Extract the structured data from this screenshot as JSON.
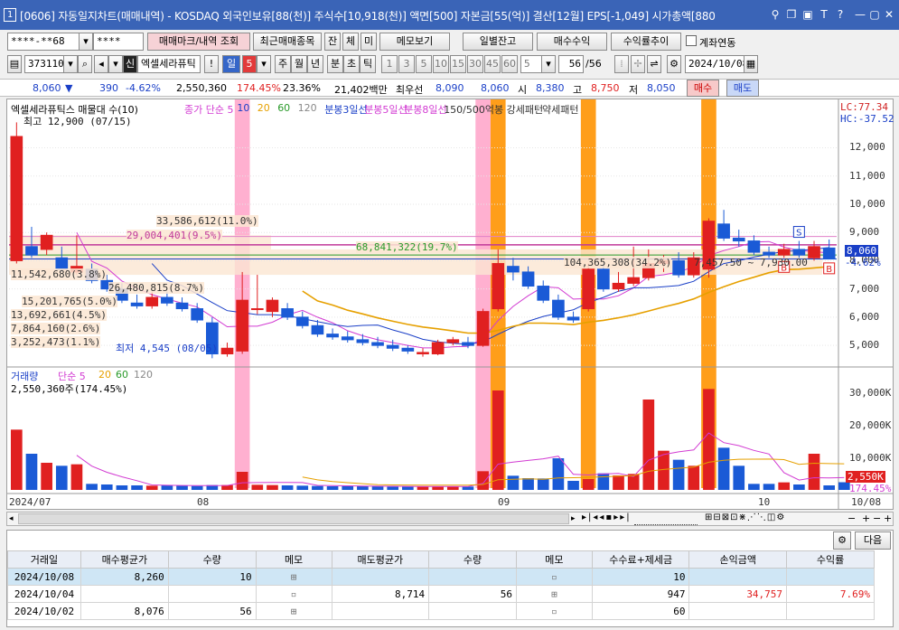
{
  "window": {
    "number": "1",
    "title": "[0606] 자동일지차트(매매내역) - KOSDAQ 외국인보유[88(천)] 주식수[10,918(천)] 액면[500] 자본금[55(억)] 결산[12월] EPS[-1,049] 시가총액[880"
  },
  "toolbar1": {
    "account": "****-**68",
    "password": "****",
    "buttons": [
      "매매마크/내역 조회",
      "최근매매종목",
      "잔",
      "체",
      "미",
      "메모보기",
      "일별잔고",
      "매수수익",
      "수익률추이"
    ],
    "checkbox_label": "계좌연동"
  },
  "toolbar2": {
    "code": "373110",
    "stock_name": "엑셀세라퓨틱",
    "period_day": "일",
    "period_value": "5",
    "periods": [
      "주",
      "월",
      "년",
      "분",
      "초",
      "틱"
    ],
    "intervals": [
      "1",
      "3",
      "5",
      "10",
      "15",
      "30",
      "45",
      "60"
    ],
    "interval_value": "5",
    "page": "56",
    "page_total": "/56",
    "date": "2024/10/08"
  },
  "quote": {
    "price": "8,060",
    "change": "390",
    "change_pct": "-4.62%",
    "volume": "2,550,360",
    "vol_ratio": "174.45%",
    "turnover": "23.36%",
    "amount": "21,402백만",
    "bid_label": "최우선",
    "bid1": "8,090",
    "bid2": "8,060",
    "open_label": "시",
    "open": "8,380",
    "high_label": "고",
    "high": "8,750",
    "low_label": "저",
    "low": "8,050",
    "buy": "매수",
    "sell": "매도"
  },
  "chart_data": {
    "type": "candlestick",
    "title": "엑셀세라퓨틱스 매물대 수(10)",
    "legend": [
      {
        "label": "종가 단순 5",
        "color": "#d23bd2"
      },
      {
        "label": "10",
        "color": "#1a3fc7"
      },
      {
        "label": "20",
        "color": "#e6a000"
      },
      {
        "label": "60",
        "color": "#2a9a2a"
      },
      {
        "label": "120",
        "color": "#888888"
      },
      {
        "label": "분봉3일선",
        "color": "#1a3fc7"
      },
      {
        "label": "분봉5일선",
        "color": "#d23bd2"
      },
      {
        "label": "분봉8일선",
        "color": "#d23bd2"
      },
      {
        "label": "150/500억봉 강세패턴",
        "color": "#333333"
      },
      {
        "label": "약세패턴",
        "color": "#333333"
      }
    ],
    "y_ticks": [
      12000,
      11000,
      10000,
      9000,
      8000,
      7000,
      6000,
      5000
    ],
    "ylim": [
      4300,
      13200
    ],
    "lc": "LC:77.34",
    "hc": "HC:-37.52",
    "last_price_label": "8,060",
    "last_pct_label": "-4.62%",
    "x_labels": [
      "2024/07",
      "08",
      "09",
      "10",
      "10/08"
    ],
    "max_label": "최고 12,900 (07/15)",
    "min_label": "최저 4,545 (08/05)",
    "volume_profile": [
      "33,586,612(11.0%)",
      "29,004,401(9.5%)",
      "68,841,322(19.7%)",
      "11,542,680(3.8%)",
      "26,480,815(8.7%)",
      "15,201,765(5.0%)",
      "13,692,661(4.5%)",
      "7,864,160(2.6%)",
      "3,252,473(1.1%)",
      "104,365,308(34.2%)"
    ],
    "range_note": "7,457.50 ~ 7,930.00",
    "candles": [
      {
        "o": 8000,
        "h": 12900,
        "l": 7900,
        "c": 12400
      },
      {
        "o": 8500,
        "h": 9200,
        "l": 8100,
        "c": 8200
      },
      {
        "o": 8400,
        "h": 9000,
        "l": 8200,
        "c": 8900
      },
      {
        "o": 8100,
        "h": 8500,
        "l": 7600,
        "c": 7700
      },
      {
        "o": 7600,
        "h": 8900,
        "l": 7500,
        "c": 7800
      },
      {
        "o": 7700,
        "h": 7900,
        "l": 7200,
        "c": 7300
      },
      {
        "o": 7300,
        "h": 7500,
        "l": 6900,
        "c": 7000
      },
      {
        "o": 7000,
        "h": 7200,
        "l": 6500,
        "c": 6600
      },
      {
        "o": 6500,
        "h": 6800,
        "l": 6300,
        "c": 6400
      },
      {
        "o": 6400,
        "h": 6900,
        "l": 6300,
        "c": 6700
      },
      {
        "o": 6700,
        "h": 6900,
        "l": 6400,
        "c": 6500
      },
      {
        "o": 6500,
        "h": 6700,
        "l": 6200,
        "c": 6300
      },
      {
        "o": 6300,
        "h": 6500,
        "l": 5800,
        "c": 5900
      },
      {
        "o": 5800,
        "h": 6000,
        "l": 4545,
        "c": 4700
      },
      {
        "o": 4700,
        "h": 5100,
        "l": 4600,
        "c": 4900
      },
      {
        "o": 4800,
        "h": 7600,
        "l": 4700,
        "c": 6600
      },
      {
        "o": 6300,
        "h": 7500,
        "l": 6100,
        "c": 6300
      },
      {
        "o": 6200,
        "h": 6700,
        "l": 6000,
        "c": 6600
      },
      {
        "o": 6300,
        "h": 6500,
        "l": 5900,
        "c": 6000
      },
      {
        "o": 6000,
        "h": 6200,
        "l": 5600,
        "c": 5700
      },
      {
        "o": 5700,
        "h": 5900,
        "l": 5300,
        "c": 5400
      },
      {
        "o": 5400,
        "h": 5600,
        "l": 5200,
        "c": 5300
      },
      {
        "o": 5300,
        "h": 5500,
        "l": 5100,
        "c": 5200
      },
      {
        "o": 5200,
        "h": 5400,
        "l": 5000,
        "c": 5100
      },
      {
        "o": 5100,
        "h": 5300,
        "l": 4900,
        "c": 5000
      },
      {
        "o": 5000,
        "h": 5200,
        "l": 4800,
        "c": 4900
      },
      {
        "o": 4900,
        "h": 5000,
        "l": 4700,
        "c": 4800
      },
      {
        "o": 4700,
        "h": 4900,
        "l": 4600,
        "c": 4750
      },
      {
        "o": 4700,
        "h": 5200,
        "l": 4650,
        "c": 5100
      },
      {
        "o": 5100,
        "h": 5300,
        "l": 5000,
        "c": 5200
      },
      {
        "o": 5100,
        "h": 5300,
        "l": 4900,
        "c": 5000
      },
      {
        "o": 5000,
        "h": 6300,
        "l": 4950,
        "c": 6200
      },
      {
        "o": 6300,
        "h": 8400,
        "l": 6200,
        "c": 7900
      },
      {
        "o": 7800,
        "h": 8100,
        "l": 7300,
        "c": 7600
      },
      {
        "o": 7600,
        "h": 7800,
        "l": 7000,
        "c": 7100
      },
      {
        "o": 7100,
        "h": 7300,
        "l": 6500,
        "c": 6600
      },
      {
        "o": 6600,
        "h": 6800,
        "l": 5900,
        "c": 6000
      },
      {
        "o": 6000,
        "h": 6200,
        "l": 5800,
        "c": 5900
      },
      {
        "o": 6300,
        "h": 7900,
        "l": 6200,
        "c": 7700
      },
      {
        "o": 7700,
        "h": 7900,
        "l": 6900,
        "c": 7000
      },
      {
        "o": 7000,
        "h": 7600,
        "l": 6900,
        "c": 7200
      },
      {
        "o": 7200,
        "h": 8500,
        "l": 7100,
        "c": 7400
      },
      {
        "o": 7400,
        "h": 8400,
        "l": 7300,
        "c": 7900
      },
      {
        "o": 7900,
        "h": 8200,
        "l": 7600,
        "c": 8000
      },
      {
        "o": 8000,
        "h": 8300,
        "l": 7400,
        "c": 7500
      },
      {
        "o": 7500,
        "h": 8300,
        "l": 7400,
        "c": 8100
      },
      {
        "o": 7700,
        "h": 9500,
        "l": 7400,
        "c": 9400
      },
      {
        "o": 9300,
        "h": 9800,
        "l": 8700,
        "c": 8800
      },
      {
        "o": 8800,
        "h": 9100,
        "l": 8500,
        "c": 8700
      },
      {
        "o": 8700,
        "h": 8900,
        "l": 8200,
        "c": 8300
      },
      {
        "o": 8300,
        "h": 8500,
        "l": 8100,
        "c": 8200
      },
      {
        "o": 8200,
        "h": 8600,
        "l": 8100,
        "c": 8400
      },
      {
        "o": 8400,
        "h": 8700,
        "l": 8100,
        "c": 8200
      },
      {
        "o": 8100,
        "h": 8700,
        "l": 8000,
        "c": 8500
      },
      {
        "o": 8450,
        "h": 8750,
        "l": 8050,
        "c": 8060
      }
    ],
    "volume_labels": {
      "title": "거래량",
      "ma": [
        "단순 5",
        "20",
        "60",
        "120"
      ],
      "current": "2,550,360주(174.45%)",
      "ticks": [
        "30,000K",
        "20,000K",
        "10,000K"
      ],
      "last_label": "2,550K",
      "last_pct": "174.45%"
    },
    "volumes": [
      20000,
      12000,
      9000,
      8000,
      8500,
      2000,
      1800,
      1500,
      1500,
      1400,
      1500,
      1400,
      1300,
      1600,
      1600,
      6000,
      1700,
      1600,
      1500,
      1400,
      1300,
      1200,
      1300,
      1200,
      1200,
      1100,
      1100,
      1100,
      1200,
      1200,
      1100,
      6200,
      33000,
      4700,
      3900,
      3800,
      10500,
      3000,
      3600,
      5500,
      4800,
      5300,
      30000,
      13000,
      10000,
      8000,
      33500,
      14000,
      8000,
      2000,
      2000,
      2500,
      1800,
      12000,
      1500,
      2550
    ]
  },
  "bottom_buttons": {
    "next": "다음"
  },
  "table": {
    "headers": [
      "거래일",
      "매수평균가",
      "수량",
      "메모",
      "매도평균가",
      "수량",
      "메모",
      "수수료+제세금",
      "손익금액",
      "수익률"
    ],
    "rows": [
      [
        "2024/10/08",
        "8,260",
        "10",
        "",
        "",
        "",
        "",
        "10",
        "",
        ""
      ],
      [
        "2024/10/04",
        "",
        "",
        "",
        "8,714",
        "56",
        "",
        "947",
        "34,757",
        "7.69%"
      ],
      [
        "2024/10/02",
        "8,076",
        "56",
        "",
        "",
        "",
        "",
        "60",
        "",
        ""
      ]
    ]
  }
}
